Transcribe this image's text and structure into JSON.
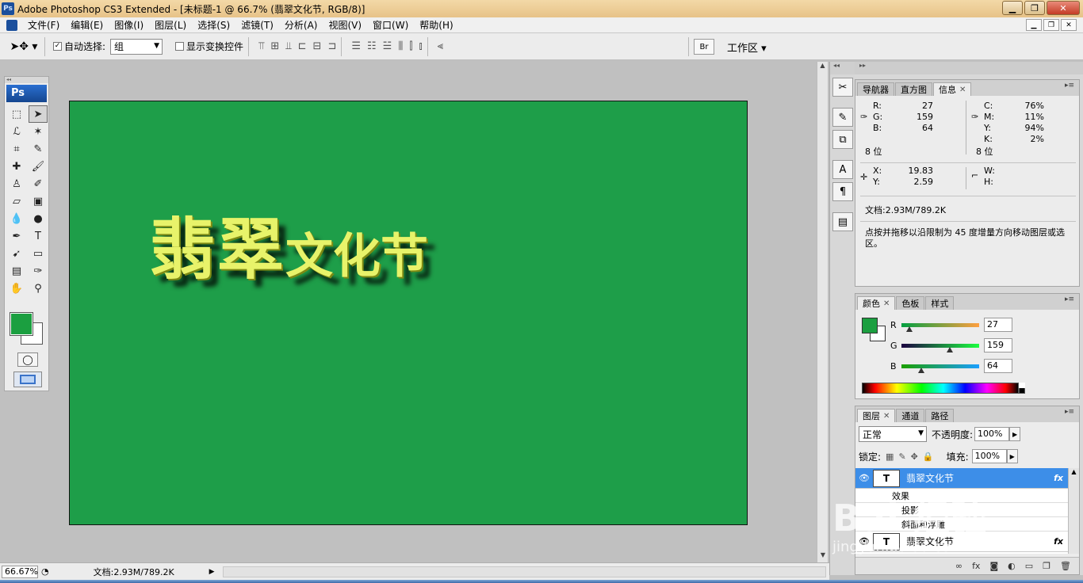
{
  "window": {
    "title": "Adobe Photoshop CS3 Extended - [未标题-1 @ 66.7% (翡翠文化节, RGB/8)]",
    "app_icon": "Ps"
  },
  "menu": [
    "文件(F)",
    "编辑(E)",
    "图像(I)",
    "图层(L)",
    "选择(S)",
    "滤镜(T)",
    "分析(A)",
    "视图(V)",
    "窗口(W)",
    "帮助(H)"
  ],
  "options": {
    "auto_select_label": "自动选择:",
    "auto_select_value": "组",
    "show_transform_label": "显示变换控件",
    "workspace_label": "工作区"
  },
  "tools": {
    "logo": "Ps"
  },
  "canvas": {
    "text_big": "翡翠",
    "text_small": "文化节",
    "bg_color": "#1e9e49",
    "text_color": "#e8f36a"
  },
  "status": {
    "zoom": "66.67%",
    "doc": "文档:2.93M/789.2K"
  },
  "info_panel": {
    "tabs": [
      "导航器",
      "直方图",
      "信息"
    ],
    "rgb": [
      [
        "R:",
        "27"
      ],
      [
        "G:",
        "159"
      ],
      [
        "B:",
        "64"
      ]
    ],
    "cmyk": [
      [
        "C:",
        "76%"
      ],
      [
        "M:",
        "11%"
      ],
      [
        "Y:",
        "94%"
      ],
      [
        "K:",
        "2%"
      ]
    ],
    "bits_left": "8 位",
    "bits_right": "8 位",
    "xy": [
      [
        "X:",
        "19.83"
      ],
      [
        "Y:",
        "2.59"
      ]
    ],
    "wh": [
      [
        "W:",
        ""
      ],
      [
        "H:",
        ""
      ]
    ],
    "doc": "文档:2.93M/789.2K",
    "hint": "点按并拖移以沿限制为 45 度增量方向移动图层或选区。"
  },
  "color_panel": {
    "tabs": [
      "颜色",
      "色板",
      "样式"
    ],
    "sliders": [
      {
        "label": "R",
        "value": "27",
        "pos": 0.106,
        "gradient": "linear-gradient(to right, #009f40, #ff9f40)"
      },
      {
        "label": "G",
        "value": "159",
        "pos": 0.624,
        "gradient": "linear-gradient(to right, #1b0040, #1bff40)"
      },
      {
        "label": "B",
        "value": "64",
        "pos": 0.251,
        "gradient": "linear-gradient(to right, #1b9f00, #1b9fff)"
      }
    ],
    "fg_color": "#1b9f40"
  },
  "layers_panel": {
    "tabs": [
      "图层",
      "通道",
      "路径"
    ],
    "blend_mode": "正常",
    "opacity_label": "不透明度:",
    "opacity": "100%",
    "lock_label": "锁定:",
    "fill_label": "填充:",
    "fill": "100%",
    "layers": [
      {
        "name": "翡翠文化节",
        "thumb": "T",
        "fx": "fx",
        "selected": true
      },
      {
        "name": "翡翠文化节",
        "thumb": "T",
        "fx": "fx",
        "selected": false
      }
    ],
    "effects_label": "效果",
    "effects": [
      "投影",
      "斜面和浮雕"
    ]
  },
  "watermark": {
    "main": "Bai 经验",
    "sub": "jingyan.baidu.com"
  }
}
